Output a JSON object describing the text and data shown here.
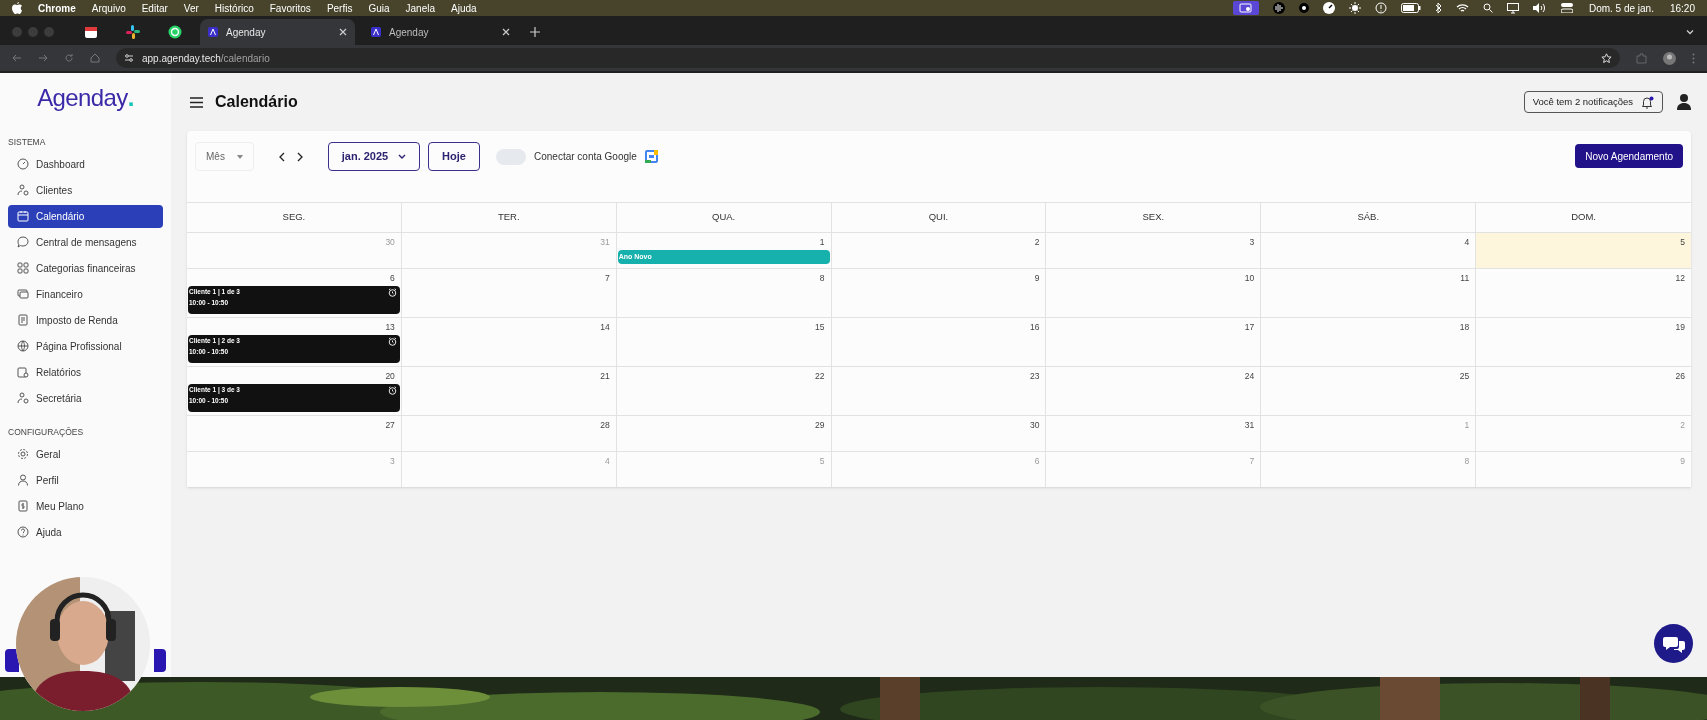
{
  "menubar": {
    "app": "Chrome",
    "menus": [
      "Arquivo",
      "Editar",
      "Ver",
      "Histórico",
      "Favoritos",
      "Perfis",
      "Guia",
      "Janela",
      "Ajuda"
    ],
    "date": "Dom. 5 de jan.",
    "time": "16:20"
  },
  "browser": {
    "tabs": [
      {
        "title": "Agenday",
        "selected": true
      },
      {
        "title": "Agenday",
        "selected": false
      }
    ],
    "url_host": "app.agenday.tech",
    "url_path": "/calendario"
  },
  "sidebar": {
    "logo": "Agenday",
    "logo_dot": ".",
    "sections": [
      {
        "title": "SISTEMA",
        "items": [
          {
            "label": "Dashboard",
            "selected": false
          },
          {
            "label": "Clientes",
            "selected": false
          },
          {
            "label": "Calendário",
            "selected": true
          },
          {
            "label": "Central de mensagens",
            "selected": false
          },
          {
            "label": "Categorias financeiras",
            "selected": false
          },
          {
            "label": "Financeiro",
            "selected": false
          },
          {
            "label": "Imposto de Renda",
            "selected": false
          },
          {
            "label": "Página Profissional",
            "selected": false
          },
          {
            "label": "Relatórios",
            "selected": false
          },
          {
            "label": "Secretária",
            "selected": false
          }
        ]
      },
      {
        "title": "CONFIGURAÇÕES",
        "items": [
          {
            "label": "Geral",
            "selected": false
          },
          {
            "label": "Perfil",
            "selected": false
          },
          {
            "label": "Meu Plano",
            "selected": false
          },
          {
            "label": "Ajuda",
            "selected": false
          }
        ]
      }
    ]
  },
  "header": {
    "title": "Calendário",
    "notifications": "Você tem 2 notificações",
    "unread": true
  },
  "toolbar": {
    "view": "Mês",
    "month": "jan. 2025",
    "today": "Hoje",
    "google_label": "Conectar conta Google",
    "google_connected": false,
    "new_button": "Novo Agendamento"
  },
  "calendar": {
    "weekdays": [
      "SEG.",
      "TER.",
      "QUA.",
      "QUI.",
      "SEX.",
      "SÁB.",
      "DOM."
    ],
    "weeks": [
      [
        {
          "day": "30",
          "outside": true,
          "today": false
        },
        {
          "day": "31",
          "outside": true,
          "today": false
        },
        {
          "day": "1",
          "outside": false,
          "today": false,
          "events": [
            {
              "kind": "holiday",
              "title": "Ano Novo"
            }
          ]
        },
        {
          "day": "2",
          "outside": false,
          "today": false
        },
        {
          "day": "3",
          "outside": false,
          "today": false
        },
        {
          "day": "4",
          "outside": false,
          "today": false
        },
        {
          "day": "5",
          "outside": false,
          "today": true
        }
      ],
      [
        {
          "day": "6",
          "outside": false,
          "today": false,
          "events": [
            {
              "kind": "appointment",
              "title": "Cliente 1 | 1 de 3",
              "time": "10:00 - 10:50"
            }
          ]
        },
        {
          "day": "7",
          "outside": false,
          "today": false
        },
        {
          "day": "8",
          "outside": false,
          "today": false
        },
        {
          "day": "9",
          "outside": false,
          "today": false
        },
        {
          "day": "10",
          "outside": false,
          "today": false
        },
        {
          "day": "11",
          "outside": false,
          "today": false
        },
        {
          "day": "12",
          "outside": false,
          "today": false
        }
      ],
      [
        {
          "day": "13",
          "outside": false,
          "today": false,
          "events": [
            {
              "kind": "appointment",
              "title": "Cliente 1 | 2 de 3",
              "time": "10:00 - 10:50"
            }
          ]
        },
        {
          "day": "14",
          "outside": false,
          "today": false
        },
        {
          "day": "15",
          "outside": false,
          "today": false
        },
        {
          "day": "16",
          "outside": false,
          "today": false
        },
        {
          "day": "17",
          "outside": false,
          "today": false
        },
        {
          "day": "18",
          "outside": false,
          "today": false
        },
        {
          "day": "19",
          "outside": false,
          "today": false
        }
      ],
      [
        {
          "day": "20",
          "outside": false,
          "today": false,
          "events": [
            {
              "kind": "appointment",
              "title": "Cliente 1 | 3 de 3",
              "time": "10:00 - 10:50"
            }
          ]
        },
        {
          "day": "21",
          "outside": false,
          "today": false
        },
        {
          "day": "22",
          "outside": false,
          "today": false
        },
        {
          "day": "23",
          "outside": false,
          "today": false
        },
        {
          "day": "24",
          "outside": false,
          "today": false
        },
        {
          "day": "25",
          "outside": false,
          "today": false
        },
        {
          "day": "26",
          "outside": false,
          "today": false
        }
      ],
      [
        {
          "day": "27",
          "outside": false,
          "today": false
        },
        {
          "day": "28",
          "outside": false,
          "today": false
        },
        {
          "day": "29",
          "outside": false,
          "today": false
        },
        {
          "day": "30",
          "outside": false,
          "today": false
        },
        {
          "day": "31",
          "outside": false,
          "today": false
        },
        {
          "day": "1",
          "outside": true,
          "today": false
        },
        {
          "day": "2",
          "outside": true,
          "today": false
        }
      ],
      [
        {
          "day": "3",
          "outside": true,
          "today": false
        },
        {
          "day": "4",
          "outside": true,
          "today": false
        },
        {
          "day": "5",
          "outside": true,
          "today": false
        },
        {
          "day": "6",
          "outside": true,
          "today": false
        },
        {
          "day": "7",
          "outside": true,
          "today": false
        },
        {
          "day": "8",
          "outside": true,
          "today": false
        },
        {
          "day": "9",
          "outside": true,
          "today": false
        }
      ]
    ]
  }
}
